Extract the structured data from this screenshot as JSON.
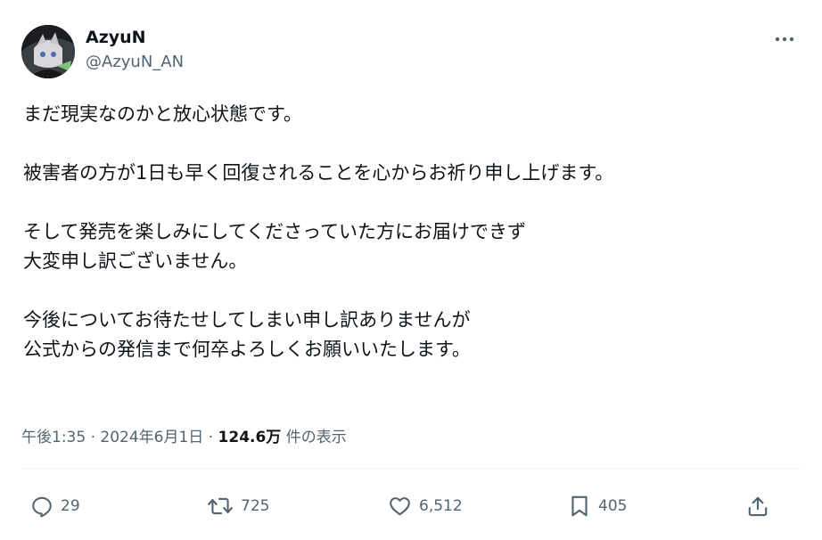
{
  "user": {
    "display_name": "AzyuN",
    "handle": "@AzyuN_AN"
  },
  "more_icon": "more-horizontal-icon",
  "tweet": {
    "lines": [
      "まだ現実なのかと放心状態です。",
      "",
      "被害者の方が1日も早く回復されることを心からお祈り申し上げます。",
      "",
      "そして発売を楽しみにしてくださっていた方にお届けできず",
      "大変申し訳ございません。",
      "",
      "今後についてお待たせしてしまい申し訳ありませんが",
      "公式からの発信まで何卒よろしくお願いいたします。"
    ]
  },
  "meta": {
    "time": "午後1:35",
    "separator1": " · ",
    "date": "2024年6月1日",
    "separator2": " · ",
    "views_count": "124.6万",
    "views_label": " 件の表示"
  },
  "actions": {
    "reply": {
      "icon": "reply-icon",
      "count": "29"
    },
    "repost": {
      "icon": "repost-icon",
      "count": "725"
    },
    "like": {
      "icon": "heart-icon",
      "count": "6,512"
    },
    "bookmark": {
      "icon": "bookmark-icon",
      "count": "405"
    },
    "share": {
      "icon": "share-icon"
    }
  },
  "colors": {
    "text": "#0f1419",
    "secondary": "#536471",
    "divider": "#eff3f4"
  }
}
